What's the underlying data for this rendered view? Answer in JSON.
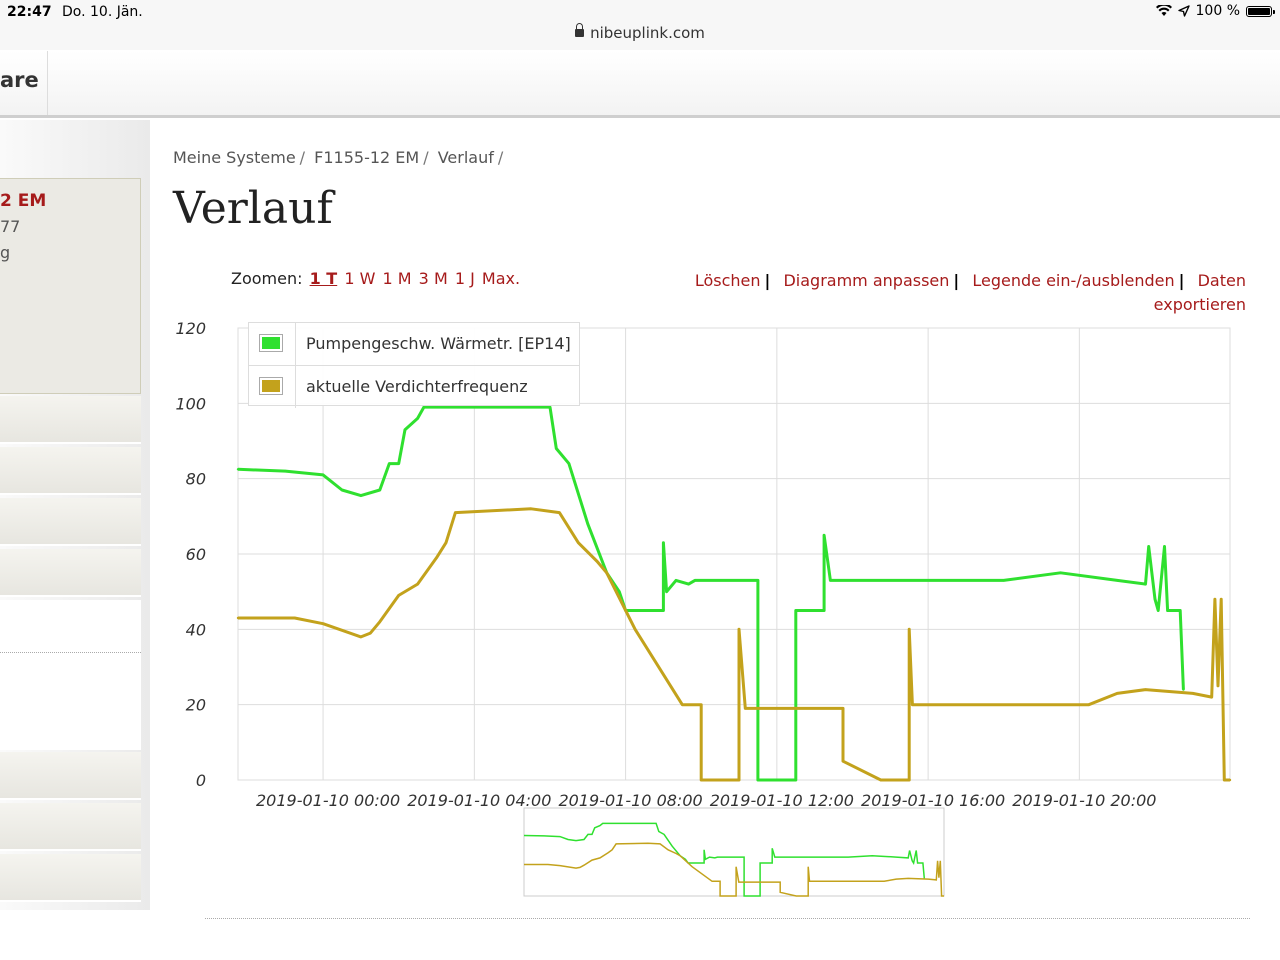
{
  "status": {
    "time": "22:47",
    "date": "Do. 10. Jän.",
    "url": "nibeuplink.com",
    "battery": "100 %"
  },
  "topnav": {
    "item": "are"
  },
  "sidebar": {
    "system_name": "2 EM",
    "line2": "77",
    "line3": "g"
  },
  "breadcrumb": [
    "Meine Systeme",
    "F1155-12 EM",
    "Verlauf"
  ],
  "page_title": "Verlauf",
  "zoom": {
    "label": "Zoomen:",
    "options": [
      "1 T",
      "1 W",
      "1 M",
      "3 M",
      "1 J",
      "Max."
    ],
    "active": "1 T"
  },
  "actions": {
    "delete": "Löschen",
    "customize": "Diagramm anpassen",
    "legend_toggle": "Legende ein-/ausblenden",
    "export": "Daten exportieren"
  },
  "colors": {
    "green": "#2fe02f",
    "gold": "#c3a21c",
    "accent": "#a61b1b"
  },
  "chart_data": {
    "type": "line",
    "ylim": [
      0,
      120
    ],
    "yticks": [
      0,
      20,
      40,
      60,
      80,
      100,
      120
    ],
    "xlim": [
      "2019-01-09 21:45",
      "2019-01-10 23:59"
    ],
    "xticks": [
      "2019-01-10 00:00",
      "2019-01-10 04:00",
      "2019-01-10 08:00",
      "2019-01-10 12:00",
      "2019-01-10 16:00",
      "2019-01-10 20:00"
    ],
    "grid": true,
    "legend": "top-left",
    "series": [
      {
        "name": "Pumpengeschw. Wärmetr. [EP14]",
        "color": "#2fe02f",
        "points": [
          [
            "2019-01-09 21:45",
            82.5
          ],
          [
            "2019-01-09 23:00",
            82
          ],
          [
            "2019-01-10 00:00",
            81
          ],
          [
            "2019-01-10 00:30",
            77
          ],
          [
            "2019-01-10 01:00",
            75.5
          ],
          [
            "2019-01-10 01:30",
            77
          ],
          [
            "2019-01-10 01:45",
            84
          ],
          [
            "2019-01-10 02:00",
            84
          ],
          [
            "2019-01-10 02:10",
            93
          ],
          [
            "2019-01-10 02:30",
            96
          ],
          [
            "2019-01-10 02:40",
            99
          ],
          [
            "2019-01-10 03:00",
            99
          ],
          [
            "2019-01-10 06:00",
            99
          ],
          [
            "2019-01-10 06:10",
            88
          ],
          [
            "2019-01-10 06:30",
            84
          ],
          [
            "2019-01-10 07:00",
            68
          ],
          [
            "2019-01-10 07:30",
            55
          ],
          [
            "2019-01-10 07:50",
            50
          ],
          [
            "2019-01-10 08:00",
            45
          ],
          [
            "2019-01-10 09:00",
            45
          ],
          [
            "2019-01-10 09:00",
            63
          ],
          [
            "2019-01-10 09:05",
            50
          ],
          [
            "2019-01-10 09:20",
            53
          ],
          [
            "2019-01-10 09:40",
            52
          ],
          [
            "2019-01-10 09:50",
            53
          ],
          [
            "2019-01-10 11:30",
            53
          ],
          [
            "2019-01-10 11:30",
            0
          ],
          [
            "2019-01-10 12:30",
            0
          ],
          [
            "2019-01-10 12:30",
            45
          ],
          [
            "2019-01-10 13:15",
            45
          ],
          [
            "2019-01-10 13:15",
            65
          ],
          [
            "2019-01-10 13:25",
            53
          ],
          [
            "2019-01-10 18:00",
            53
          ],
          [
            "2019-01-10 19:30",
            55
          ],
          [
            "2019-01-10 21:00",
            53
          ],
          [
            "2019-01-10 21:45",
            52
          ],
          [
            "2019-01-10 21:50",
            62
          ],
          [
            "2019-01-10 22:00",
            48
          ],
          [
            "2019-01-10 22:05",
            45
          ],
          [
            "2019-01-10 22:15",
            62
          ],
          [
            "2019-01-10 22:20",
            45
          ],
          [
            "2019-01-10 22:40",
            45
          ],
          [
            "2019-01-10 22:45",
            24
          ]
        ]
      },
      {
        "name": "aktuelle Verdichterfrequenz",
        "color": "#c3a21c",
        "points": [
          [
            "2019-01-09 21:45",
            43
          ],
          [
            "2019-01-09 23:15",
            43
          ],
          [
            "2019-01-10 00:00",
            41.5
          ],
          [
            "2019-01-10 01:00",
            38
          ],
          [
            "2019-01-10 01:15",
            39
          ],
          [
            "2019-01-10 01:30",
            42
          ],
          [
            "2019-01-10 02:00",
            49
          ],
          [
            "2019-01-10 02:30",
            52
          ],
          [
            "2019-01-10 03:00",
            59
          ],
          [
            "2019-01-10 03:15",
            63
          ],
          [
            "2019-01-10 03:30",
            71
          ],
          [
            "2019-01-10 05:30",
            72
          ],
          [
            "2019-01-10 06:15",
            71
          ],
          [
            "2019-01-10 06:45",
            63
          ],
          [
            "2019-01-10 07:15",
            58
          ],
          [
            "2019-01-10 07:30",
            55
          ],
          [
            "2019-01-10 08:15",
            40
          ],
          [
            "2019-01-10 09:30",
            20
          ],
          [
            "2019-01-10 10:00",
            20
          ],
          [
            "2019-01-10 10:00",
            0
          ],
          [
            "2019-01-10 11:00",
            0
          ],
          [
            "2019-01-10 11:00",
            40
          ],
          [
            "2019-01-10 11:10",
            19
          ],
          [
            "2019-01-10 13:45",
            19
          ],
          [
            "2019-01-10 13:45",
            5
          ],
          [
            "2019-01-10 14:45",
            0
          ],
          [
            "2019-01-10 15:30",
            0
          ],
          [
            "2019-01-10 15:30",
            40
          ],
          [
            "2019-01-10 15:35",
            20
          ],
          [
            "2019-01-10 20:15",
            20
          ],
          [
            "2019-01-10 21:00",
            23
          ],
          [
            "2019-01-10 21:45",
            24
          ],
          [
            "2019-01-10 23:00",
            23
          ],
          [
            "2019-01-10 23:30",
            22
          ],
          [
            "2019-01-10 23:35",
            48
          ],
          [
            "2019-01-10 23:40",
            25
          ],
          [
            "2019-01-10 23:45",
            48
          ],
          [
            "2019-01-10 23:50",
            0
          ],
          [
            "2019-01-10 23:59",
            0
          ]
        ]
      }
    ]
  }
}
